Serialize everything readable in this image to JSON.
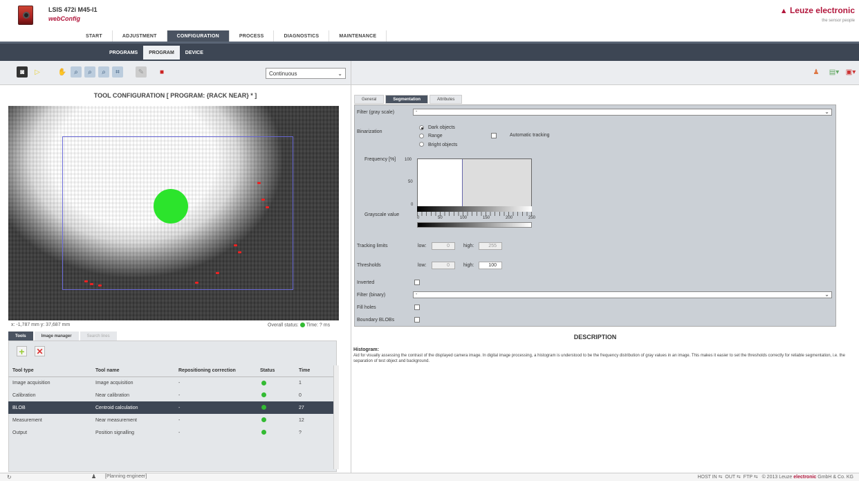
{
  "header": {
    "device": "LSIS 472i M45-I1",
    "app": "webConfig",
    "brand": "Leuze electronic",
    "brand_tagline": "the sensor people"
  },
  "main_tabs": [
    "START",
    "ADJUSTMENT",
    "CONFIGURATION",
    "PROCESS",
    "DIAGNOSTICS",
    "MAINTENANCE"
  ],
  "sub_tabs": [
    "PROGRAMS",
    "PROGRAM",
    "DEVICE"
  ],
  "toolbar": {
    "mode": "Continuous"
  },
  "tool_config": {
    "title": "TOOL CONFIGURATION   [ PROGRAM: {RACK NEAR} * ]",
    "coords": "x: -1,787 mm y: 37,687 mm",
    "overall_status": "Overall status:",
    "time": "Time: ? ms"
  },
  "bottom_tabs": [
    "Tools",
    "Image manager",
    "Search lines"
  ],
  "tool_table": {
    "headers": [
      "Tool type",
      "Tool name",
      "Repositioning correction",
      "Status",
      "Time"
    ],
    "rows": [
      {
        "type": "Image acquisition",
        "name": "Image acquisition",
        "repos": "-",
        "time": "1"
      },
      {
        "type": "Calibration",
        "name": "Near calibration",
        "repos": "-",
        "time": "0"
      },
      {
        "type": "BLOB",
        "name": "Centroid calculation",
        "repos": "-",
        "time": "27"
      },
      {
        "type": "Measurement",
        "name": "Near measurement",
        "repos": "-",
        "time": "12"
      },
      {
        "type": "Output",
        "name": "Position signalling",
        "repos": "-",
        "time": "?"
      }
    ]
  },
  "right_tabs": [
    "General",
    "Segmentation",
    "Attributes"
  ],
  "segmentation": {
    "filter_gray_label": "Filter (gray scale)",
    "filter_gray_value": "-",
    "binarization_label": "Binarization",
    "opt_dark": "Dark objects",
    "opt_range": "Range",
    "opt_bright": "Bright objects",
    "auto_tracking": "Automatic tracking",
    "frequency_label": "Frequency [%]",
    "f100": "100",
    "f50": "50",
    "f0": "0",
    "grayscale_label": "Grayscale value",
    "ticks": [
      "0",
      "50",
      "100",
      "150",
      "200",
      "250"
    ],
    "tracking_label": "Tracking limits",
    "low": "low:",
    "high": "high:",
    "track_low": "0",
    "track_high": "255",
    "thresholds_label": "Thresholds",
    "thr_low": "0",
    "thr_high": "100",
    "inverted": "Inverted",
    "filter_binary_label": "Filter (binary)",
    "filter_binary_value": "-",
    "fill_holes": "Fill holes",
    "boundary_blobs": "Boundary BLOBs"
  },
  "description": {
    "title": "DESCRIPTION",
    "heading": "Histogram:",
    "body": "Aid for visually assessing the contrast of the displayed camera image. In digital image processing, a histogram is understood to be the frequency distribution of gray values in an image. This makes it easier to set the thresholds correctly for reliable segmentation, i.e. the separation of test object and background."
  },
  "footer": {
    "user": "[Planning engineer]",
    "host": "HOST IN",
    "out": "OUT",
    "ftp": "FTP",
    "copyright_pre": "© 2013 Leuze",
    "copyright_brand": "electronic",
    "copyright_post": "GmbH & Co. KG"
  }
}
